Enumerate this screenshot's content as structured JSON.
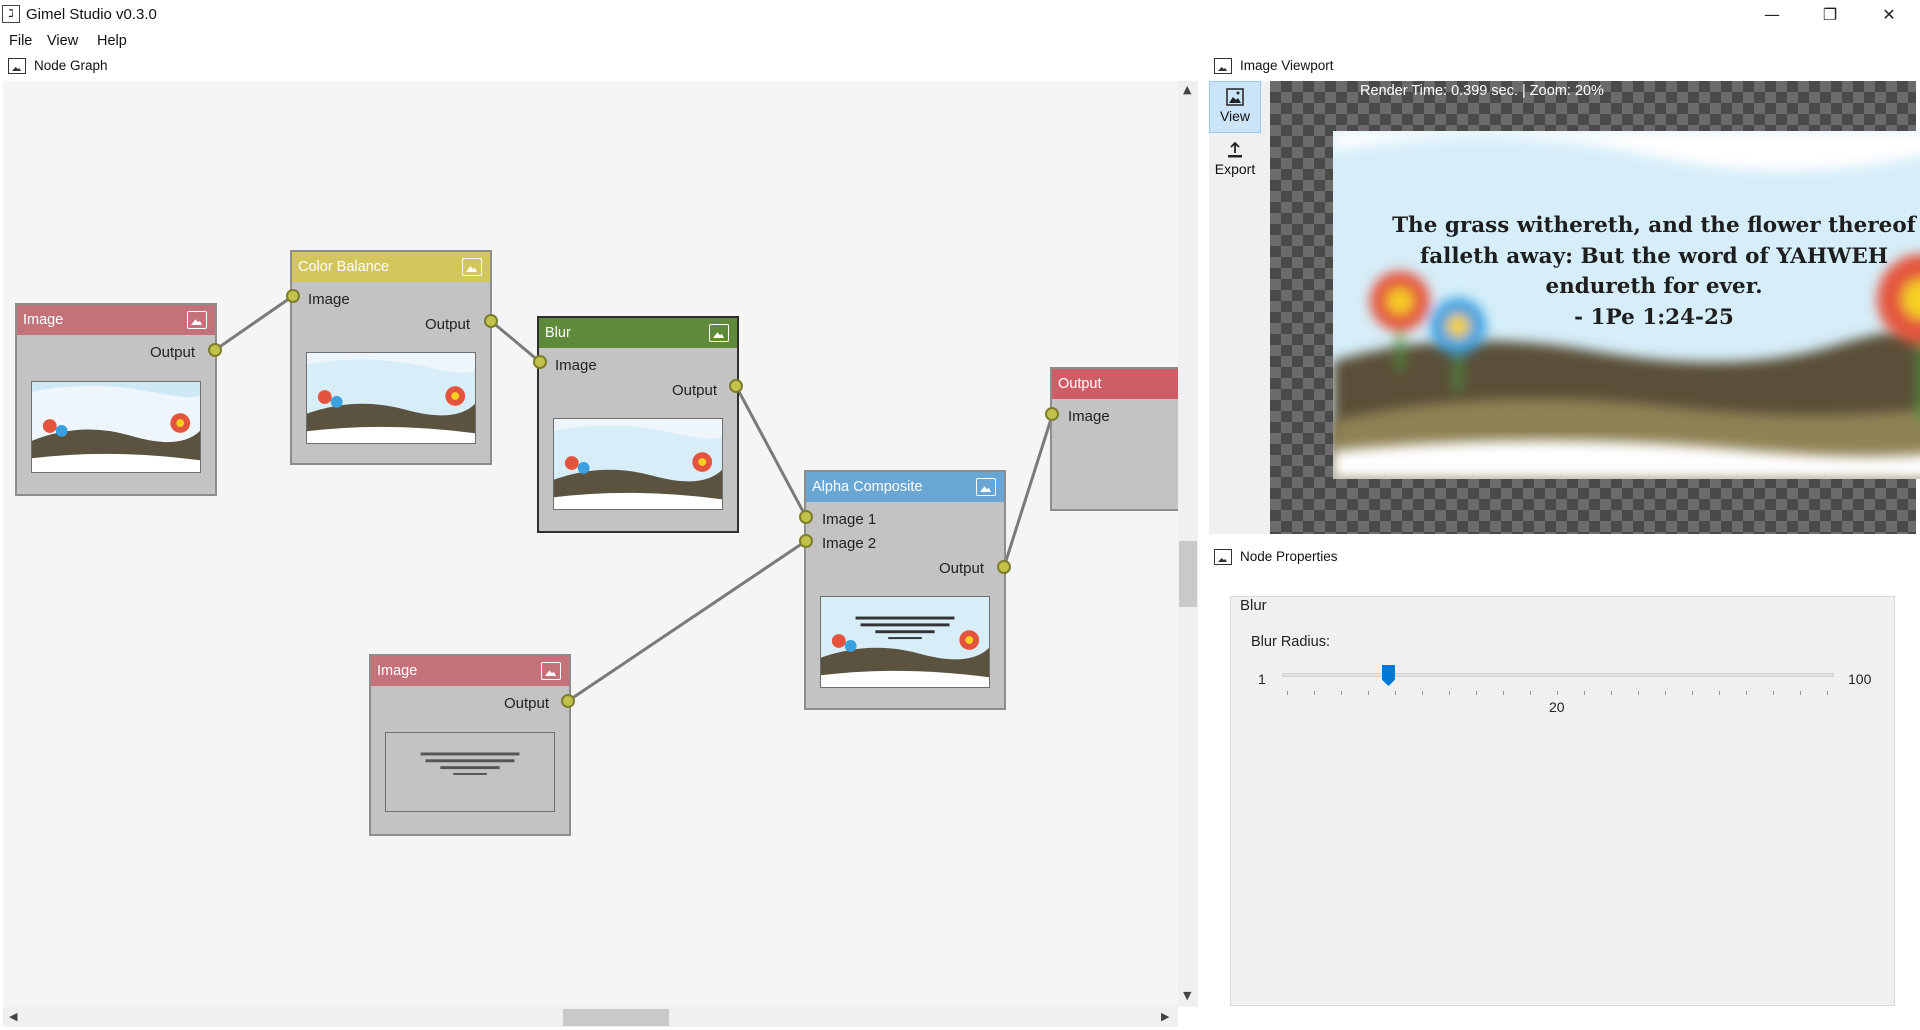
{
  "window": {
    "title": "Gimel Studio v0.3.0",
    "minimize": "—",
    "maximize": "❐",
    "close": "✕"
  },
  "menu": [
    "File",
    "View",
    "Help"
  ],
  "node_graph": {
    "title": "Node Graph",
    "nodes": {
      "image1": {
        "title": "Image",
        "color": "#c4727a",
        "output_label": "Output"
      },
      "color_balance": {
        "title": "Color Balance",
        "color": "#d4c65e",
        "input_label": "Image",
        "output_label": "Output"
      },
      "blur": {
        "title": "Blur",
        "color": "#5e8a3a",
        "input_label": "Image",
        "output_label": "Output"
      },
      "alpha_composite": {
        "title": "Alpha Composite",
        "color": "#6aa6d4",
        "input1_label": "Image 1",
        "input2_label": "Image 2",
        "output_label": "Output"
      },
      "image2": {
        "title": "Image",
        "color": "#c4727a",
        "output_label": "Output"
      },
      "output": {
        "title": "Output",
        "color": "#cf5d66",
        "input_label": "Image"
      }
    }
  },
  "viewport": {
    "title": "Image Viewport",
    "tools": [
      {
        "label": "View",
        "icon": "image-icon"
      },
      {
        "label": "Export",
        "icon": "export-icon"
      }
    ],
    "render_info": "Render Time: 0.399 sec. | Zoom: 20%",
    "verse": [
      "The grass withereth, and the flower thereof",
      "falleth away: But the word of YAHWEH",
      "endureth for ever.",
      "- 1Pe 1:24-25"
    ]
  },
  "properties": {
    "title": "Node Properties",
    "node_name": "Blur",
    "param_label": "Blur Radius:",
    "slider": {
      "min": "1",
      "max": "100",
      "value": "20",
      "position": 0.192
    }
  }
}
